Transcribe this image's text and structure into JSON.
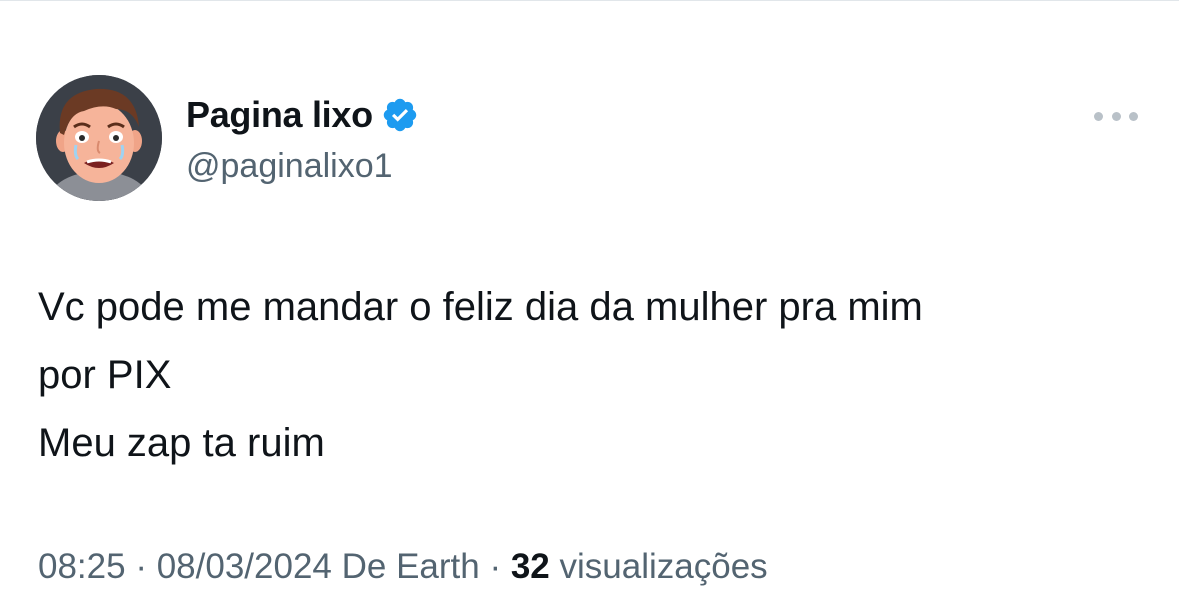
{
  "author": {
    "display_name": "Pagina lixo",
    "handle": "@paginalixo1",
    "verified": true,
    "avatar_icon": "crying-man-cartoon-avatar"
  },
  "tweet": {
    "lines": [
      "Vc pode me mandar o feliz dia da mulher pra mim",
      "por PIX",
      "Meu zap ta ruim"
    ]
  },
  "meta": {
    "time": "08:25",
    "separator": " · ",
    "date": "08/03/2024",
    "source": "De Earth",
    "views_count": "32",
    "views_label": "visualizações"
  },
  "colors": {
    "verified_badge": "#1d9bf0",
    "primary_text": "#0f1419",
    "secondary_text": "#536471"
  }
}
